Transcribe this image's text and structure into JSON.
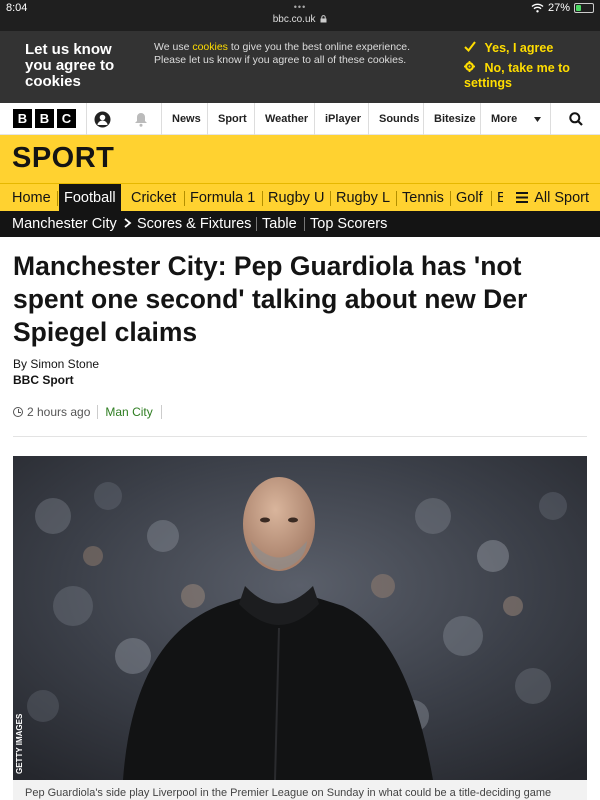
{
  "status_bar": {
    "time": "8:04",
    "dots": "•••",
    "url": "bbc.co.uk",
    "lock_icon": "lock-icon",
    "wifi_icon": "wifi-icon",
    "battery": "27%",
    "battery_level": 0.27
  },
  "cookie_banner": {
    "title": "Let us know you agree to cookies",
    "message_pre": "We use ",
    "message_link": "cookies",
    "message_post": " to give you the best online experience. Please let us know if you agree to all of these cookies.",
    "accept_label": "Yes, I agree",
    "decline_label": "No, take me to settings",
    "accent_color": "#ffdd00"
  },
  "top_nav": {
    "logo": [
      "B",
      "B",
      "C"
    ],
    "links": [
      "News",
      "Sport",
      "Weather",
      "iPlayer",
      "Sounds",
      "Bitesize",
      "More"
    ]
  },
  "sport_header": {
    "title": "SPORT",
    "brand_color": "#ffd230"
  },
  "section_nav": {
    "items": [
      "Home",
      "Football",
      "Cricket",
      "Formula 1",
      "Rugby U",
      "Rugby L",
      "Tennis",
      "Golf",
      "B"
    ],
    "active": "Football",
    "all_sport": "All Sport"
  },
  "sub_nav": {
    "items": [
      "Manchester City",
      "Scores & Fixtures",
      "Table",
      "Top Scorers"
    ]
  },
  "article": {
    "headline": "Manchester City: Pep Guardiola has 'not spent one second' talking about new Der Spiegel claims",
    "byline_prefix": "By Simon Stone",
    "byline_org": "BBC Sport",
    "timestamp": "2 hours ago",
    "topic_tag": "Man City",
    "photo_credit": "GETTY IMAGES",
    "caption": "Pep Guardiola's side play Liverpool in the Premier League on Sunday in what could be a title-deciding game"
  }
}
